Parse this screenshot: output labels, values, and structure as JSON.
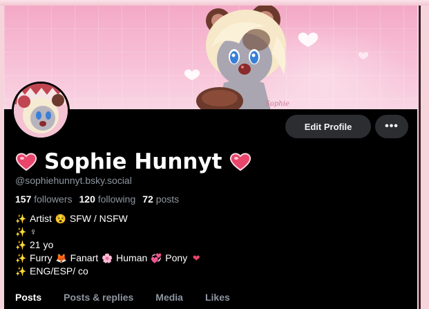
{
  "profile": {
    "display_name": "Sophie Hunnyt",
    "handle": "@sophiehunnyt.bsky.social",
    "banner_signature": "Sophie"
  },
  "stats": {
    "followers_count": "157",
    "followers_label": "followers",
    "following_count": "120",
    "following_label": "following",
    "posts_count": "72",
    "posts_label": "posts"
  },
  "buttons": {
    "edit_profile": "Edit Profile",
    "more": "•••"
  },
  "bio": {
    "line1_text": "Artist",
    "line1_text2": "SFW / NSFW",
    "line2_text": "♀",
    "line3_text": "21 yo",
    "line4_a": "Furry",
    "line4_b": "Fanart",
    "line4_c": "Human",
    "line4_d": "Pony",
    "line5_text": "ENG/ESP/ co"
  },
  "tabs": [
    {
      "label": "Posts",
      "active": true
    },
    {
      "label": "Posts & replies",
      "active": false
    },
    {
      "label": "Media",
      "active": false
    },
    {
      "label": "Likes",
      "active": false
    }
  ],
  "icons": {
    "sparkle": "sparkles-icon",
    "heart": "heart-icon",
    "fox": "fox-icon",
    "flower": "flower-icon",
    "hearts_pair": "two-hearts-icon",
    "pony": "pony-face-icon"
  },
  "colors": {
    "background": "#000000",
    "button_bg": "#2b2d31",
    "muted_text": "#8e96a0",
    "banner_pink": "#f7c0d6",
    "heart_red": "#e8456b"
  }
}
